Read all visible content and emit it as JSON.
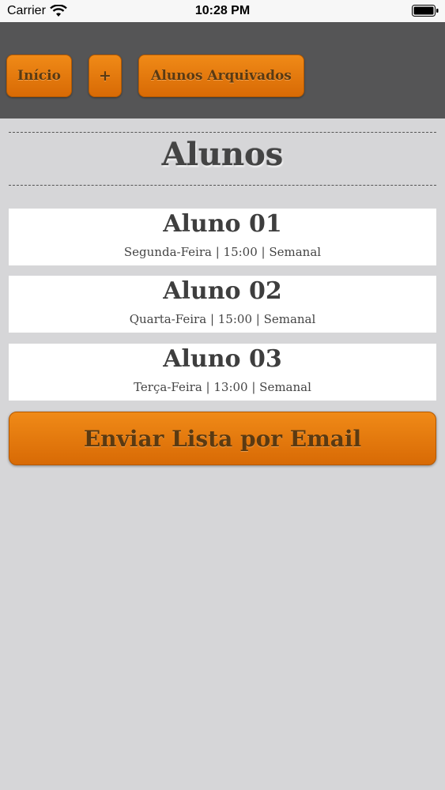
{
  "status_bar": {
    "carrier": "Carrier",
    "time": "10:28 PM",
    "wifi_icon": "wifi-icon",
    "battery_icon": "battery-icon"
  },
  "nav": {
    "home_label": "Início",
    "add_label": "+",
    "archived_label": "Alunos Arquivados"
  },
  "page": {
    "title": "Alunos"
  },
  "students": [
    {
      "name": "Aluno 01",
      "schedule": "Segunda-Feira | 15:00 | Semanal"
    },
    {
      "name": "Aluno 02",
      "schedule": "Quarta-Feira | 15:00 | Semanal"
    },
    {
      "name": "Aluno 03",
      "schedule": "Terça-Feira | 13:00 | Semanal"
    }
  ],
  "actions": {
    "email_label": "Enviar Lista por Email"
  },
  "colors": {
    "accent": "#e8790c",
    "nav_background": "#555556",
    "page_background": "#d6d6d8"
  }
}
